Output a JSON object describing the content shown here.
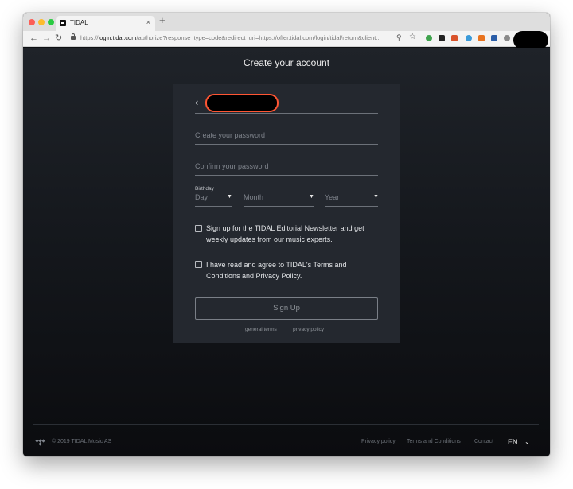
{
  "browser": {
    "tab_title": "TIDAL",
    "tab_close": "×",
    "new_tab": "+",
    "url_scheme": "https://",
    "url_host": "login.tidal.com",
    "url_rest": "/authorize?response_type=code&redirect_uri=https://offer.tidal.com/login/tidal/return&client...",
    "icons": [
      "back-icon",
      "forward-icon",
      "reload-icon",
      "lock-icon",
      "key-icon",
      "star-icon",
      "evernote-icon",
      "extension-icon",
      "extension-icon",
      "extension-icon",
      "extension-icon",
      "bookmark-icon",
      "globe-icon"
    ],
    "colors": {
      "traffic_red": "#fc5f57",
      "traffic_yellow": "#fdbc2e",
      "traffic_green": "#2acb42"
    }
  },
  "page": {
    "title": "Create your account",
    "form": {
      "password_placeholder": "Create your password",
      "confirm_placeholder": "Confirm your password",
      "birthday_label": "Birthday",
      "day_label": "Day",
      "month_label": "Month",
      "year_label": "Year",
      "newsletter_text": "Sign up for the TIDAL Editorial Newsletter and get weekly updates from our music experts.",
      "terms_text": "I have read and agree to TIDAL's Terms and Conditions and Privacy Policy.",
      "signup_label": "Sign Up",
      "general_terms": "general terms",
      "privacy_policy": "privacy policy"
    },
    "highlight_color": "#ff5533"
  },
  "footer": {
    "copyright": "© 2019 TIDAL Music AS",
    "links": [
      "Privacy policy",
      "Terms and Conditions",
      "Contact"
    ],
    "language": "EN"
  }
}
